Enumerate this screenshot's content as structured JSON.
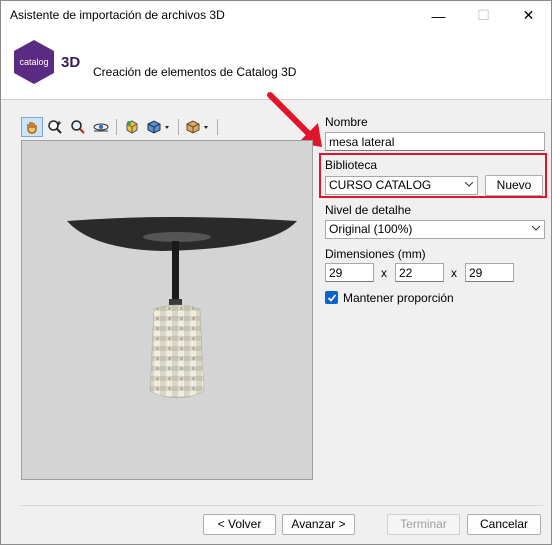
{
  "window": {
    "title": "Asistente de importación de archivos 3D",
    "minimize_glyph": "—",
    "maximize_glyph": "☐",
    "close_glyph": "✕"
  },
  "header": {
    "logo_text": "catalog",
    "logo_suffix": "3D",
    "subtitle": "Creación de elementos de Catalog 3D"
  },
  "toolbar": {
    "icons": [
      "move-hand-icon",
      "zoom-in-icon",
      "zoom-fit-icon",
      "orbit-eye-icon",
      "cube-color-icon",
      "cube-view-icon",
      "box-material-icon"
    ]
  },
  "form": {
    "name_label": "Nombre",
    "name_value": "mesa lateral",
    "library_label": "Biblioteca",
    "library_value": "CURSO CATALOG",
    "new_button": "Nuevo",
    "detail_label": "Nivel de detalhe",
    "detail_value": "Original (100%)",
    "dimensions_label": "Dimensiones (mm)",
    "dim_x": "29",
    "dim_sep1": "x",
    "dim_y": "22",
    "dim_sep2": "x",
    "dim_z": "29",
    "keep_proportion_label": "Mantener proporción",
    "keep_proportion_checked": true
  },
  "footer": {
    "back": "< Volver",
    "next": "Avanzar >",
    "finish": "Terminar",
    "cancel": "Cancelar"
  },
  "colors": {
    "accent": "#0a64c8",
    "highlight": "#e0152a",
    "logo_bg": "#5b2a82"
  }
}
